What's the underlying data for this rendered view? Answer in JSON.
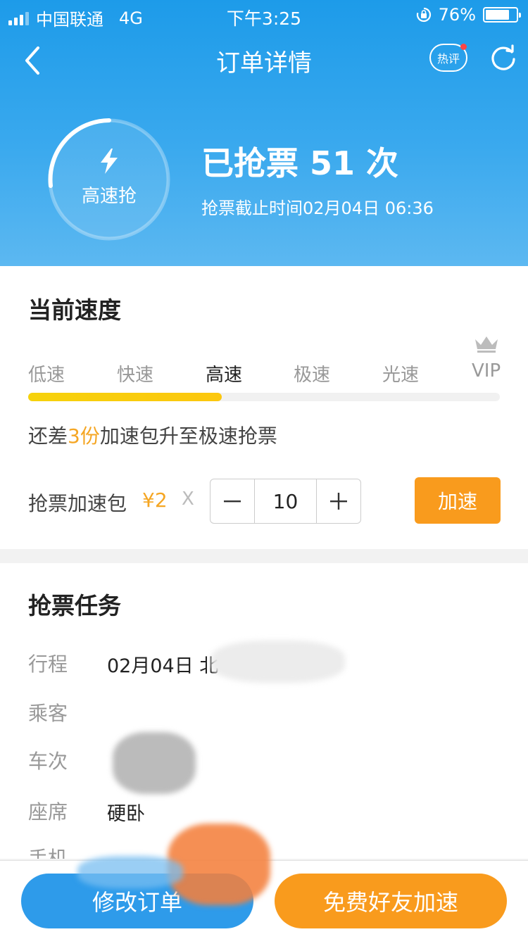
{
  "status_bar": {
    "carrier": "中国联通",
    "network": "4G",
    "time": "下午3:25",
    "battery_percent": "76%",
    "battery_level": 0.76
  },
  "nav": {
    "title": "订单详情",
    "hot_label": "热评",
    "back_icon": "chevron-left-icon",
    "refresh_icon": "refresh-icon"
  },
  "summary": {
    "ring_label": "高速抢",
    "grab_count_text": "已抢票 51 次",
    "deadline": "抢票截止时间02月04日 06:36"
  },
  "speed": {
    "title": "当前速度",
    "levels": [
      "低速",
      "快速",
      "高速",
      "极速",
      "光速",
      "VIP"
    ],
    "active_level": "高速",
    "progress": 0.41,
    "need_prefix": "还差",
    "need_count": "3份",
    "need_suffix": "加速包升至极速抢票",
    "pack_label": "抢票加速包",
    "pack_price": "¥2",
    "pack_times": "X",
    "quantity": "10",
    "speedup_label": "加速"
  },
  "task": {
    "title": "抢票任务",
    "rows": [
      {
        "label": "行程",
        "value": "02月04日 北"
      },
      {
        "label": "乘客",
        "value": ""
      },
      {
        "label": "车次",
        "value": ""
      },
      {
        "label": "座席",
        "value": "硬卧"
      },
      {
        "label": "手机",
        "value": ""
      }
    ]
  },
  "footer": {
    "modify_label": "修改订单",
    "friend_label": "免费好友加速"
  },
  "colors": {
    "header_blue": "#2a9fea",
    "accent_orange": "#f99b1d",
    "progress_yellow": "#f6d20c"
  }
}
